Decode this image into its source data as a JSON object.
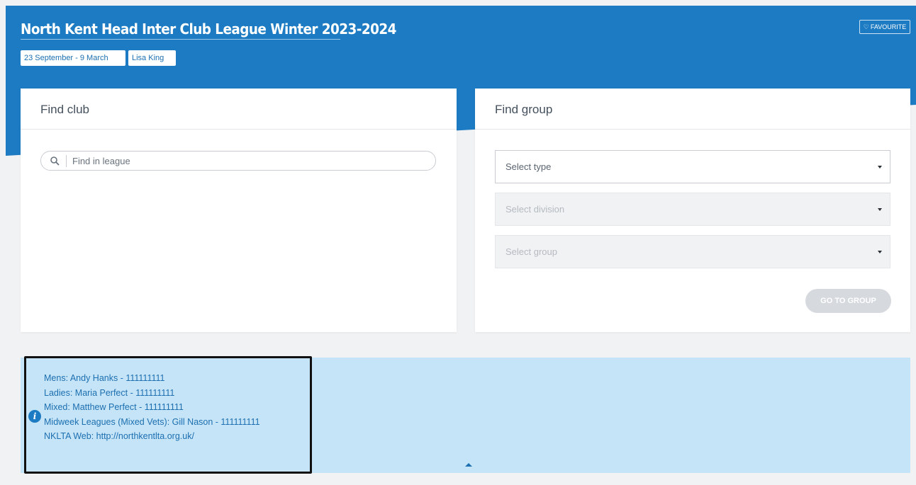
{
  "header": {
    "title": "North Kent Head Inter Club League Winter 2023-2024",
    "dates": "23 September - 9 March",
    "organiser": "Lisa King",
    "favourite_label": "FAVOURITE"
  },
  "find_club": {
    "title": "Find club",
    "search_placeholder": "Find in league"
  },
  "find_group": {
    "title": "Find group",
    "select_type": "Select type",
    "select_division": "Select division",
    "select_group": "Select group",
    "go_button": "GO TO GROUP"
  },
  "info": {
    "lines": [
      "Mens: Andy Hanks - 111111111",
      "Ladies: Maria Perfect - 111111111",
      "Mixed: Matthew Perfect - 111111111",
      "Midweek Leagues (Mixed Vets): Gill Nason - 111111111",
      "NKLTA Web: http://northkentlta.org.uk/"
    ]
  },
  "icons": {
    "favourite": "heart-icon",
    "search": "search-icon",
    "dropdown": "caret-down-icon",
    "info": "info-icon",
    "collapse": "caret-up-icon"
  },
  "colors": {
    "brand_blue": "#1c7bc2",
    "info_background": "#c5e4f8",
    "disabled_button": "#d6d9de",
    "highlight_border": "#111111"
  }
}
